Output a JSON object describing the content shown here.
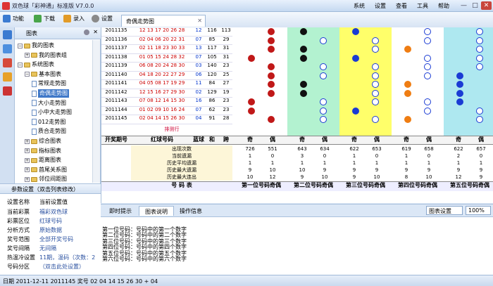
{
  "window": {
    "title": "双色球「彩神通」标准版   V7.0.0",
    "menu": [
      "系统",
      "设置",
      "查看",
      "工具",
      "帮助"
    ],
    "btn_min": "—",
    "btn_max": "□",
    "btn_close": "✕"
  },
  "toolbar": {
    "items": [
      "功能",
      "下载",
      "录入",
      "设置"
    ],
    "doc_tab": "奇偶走势图",
    "doc_tab_close": "✕"
  },
  "tree": {
    "title": "图表",
    "items": [
      {
        "label": "我的图表",
        "level": 0,
        "exp": "-"
      },
      {
        "label": "我的图表组",
        "level": 1,
        "exp": "+"
      },
      {
        "label": "系统图表",
        "level": 0,
        "exp": "-"
      },
      {
        "label": "基本图表",
        "level": 1,
        "exp": "-"
      },
      {
        "label": "常规走势图",
        "level": 2,
        "exp": ""
      },
      {
        "label": "奇偶走势图",
        "level": 2,
        "exp": "",
        "selected": true
      },
      {
        "label": "大小走势图",
        "level": 2,
        "exp": ""
      },
      {
        "label": "小中大走势图",
        "level": 2,
        "exp": ""
      },
      {
        "label": "012走势图",
        "level": 2,
        "exp": ""
      },
      {
        "label": "质合走势图",
        "level": 2,
        "exp": ""
      },
      {
        "label": "综合图表",
        "level": 1,
        "exp": "+"
      },
      {
        "label": "指标图表",
        "level": 1,
        "exp": "+"
      },
      {
        "label": "距离图表",
        "level": 1,
        "exp": "+"
      },
      {
        "label": "首尾关系图",
        "level": 1,
        "exp": "+"
      },
      {
        "label": "邻位间距图",
        "level": 1,
        "exp": "+"
      }
    ]
  },
  "params": {
    "title": "参数设置（双击列表修改）",
    "header": [
      "设置名称",
      "当前设置值"
    ],
    "rows": [
      [
        "当前彩票",
        "福彩双色球"
      ],
      [
        "彩票区位",
        "红球号码"
      ],
      [
        "分析方式",
        "原始数据"
      ],
      [
        "奖号范围",
        "全部开奖号码"
      ],
      [
        "奖号间隔",
        "无间隔"
      ],
      [
        "热温冷设置",
        "11期，温码（次数：2"
      ],
      [
        "号码分区",
        "（双击此处设置）"
      ]
    ]
  },
  "grid": {
    "rows": [
      {
        "issue": "2011135",
        "reds": "12 13 17 20 26 28",
        "blue": "12",
        "he": "116",
        "sum": "113",
        "d": "14"
      },
      {
        "issue": "2011136",
        "reds": "02 04 06 20 22 31",
        "blue": "07",
        "he": "85",
        "sum": "29",
        "d": ""
      },
      {
        "issue": "2011137",
        "reds": "02 11 18 23 30 33",
        "blue": "13",
        "he": "117",
        "sum": "31",
        "d": ""
      },
      {
        "issue": "2011138",
        "reds": "01 05 15 24 28 32",
        "blue": "07",
        "he": "105",
        "sum": "31",
        "d": ""
      },
      {
        "issue": "2011139",
        "reds": "06 08 20 24 28 30",
        "blue": "03",
        "he": "140",
        "sum": "23",
        "d": ""
      },
      {
        "issue": "2011140",
        "reds": "04 18 20 22 27 29",
        "blue": "06",
        "he": "120",
        "sum": "25",
        "d": ""
      },
      {
        "issue": "2011141",
        "reds": "04 05 08 17 19 29",
        "blue": "11",
        "he": "84",
        "sum": "27",
        "d": ""
      },
      {
        "issue": "2011142",
        "reds": "12 15 16 27 29 30",
        "blue": "02",
        "he": "129",
        "sum": "19",
        "d": ""
      },
      {
        "issue": "2011143",
        "reds": "07 08 12 14 15 30",
        "blue": "16",
        "he": "86",
        "sum": "23",
        "d": ""
      },
      {
        "issue": "2011144",
        "reds": "01 02 09 10 16 24",
        "blue": "07",
        "he": "62",
        "sum": "23",
        "d": ""
      },
      {
        "issue": "2011145",
        "reds": "02 04 14 15 26 30",
        "blue": "04",
        "he": "91",
        "sum": "28",
        "d": ""
      }
    ],
    "pai": "排测行",
    "head": {
      "issue": "开奖期号",
      "reds": "红球号码",
      "blue": "蓝球",
      "he": "和",
      "kua": "跨",
      "odd": "奇",
      "even": "偶"
    },
    "stats_labels": [
      "出现次数",
      "当前遗漏",
      "历史平均遗漏",
      "历史最大遗漏",
      "历史最大连出"
    ],
    "stats": [
      [
        "726",
        "551",
        "643",
        "634",
        "622",
        "653",
        "619",
        "658",
        "622",
        "657"
      ],
      [
        "1",
        "0",
        "3",
        "0",
        "1",
        "0",
        "1",
        "0",
        "2",
        "0"
      ],
      [
        "1",
        "1",
        "1",
        "1",
        "1",
        "1",
        "1",
        "1",
        "1",
        "1"
      ],
      [
        "9",
        "10",
        "10",
        "9",
        "9",
        "9",
        "9",
        "9",
        "9",
        "9"
      ],
      [
        "10",
        "12",
        "9",
        "10",
        "9",
        "10",
        "8",
        "10",
        "12",
        "9"
      ]
    ],
    "footer": {
      "label": "号  码  表",
      "cols": [
        "第一位号码奇偶",
        "第二位号码奇偶",
        "第三位号码奇偶",
        "第四位号码奇偶",
        "第五位号码奇偶"
      ]
    }
  },
  "bottom": {
    "tabs": [
      "即时提示",
      "图表说明",
      "操作信息"
    ],
    "active": 1,
    "chart_setting": "图表设置",
    "zoom": "100%",
    "lines": [
      "第一位号码：号码中的第一个数字",
      "第二位号码：号码中的第二个数字",
      "第三位号码：号码中的第三个数字",
      "第四位号码：号码中的第四个数字",
      "第五位号码：号码中的第五个数字",
      "第六位号码：号码中的第六个数字"
    ]
  },
  "status": {
    "text": "日期 2011-12-11 2011145 奖号 02 04 14 15 26 30 + 04"
  }
}
